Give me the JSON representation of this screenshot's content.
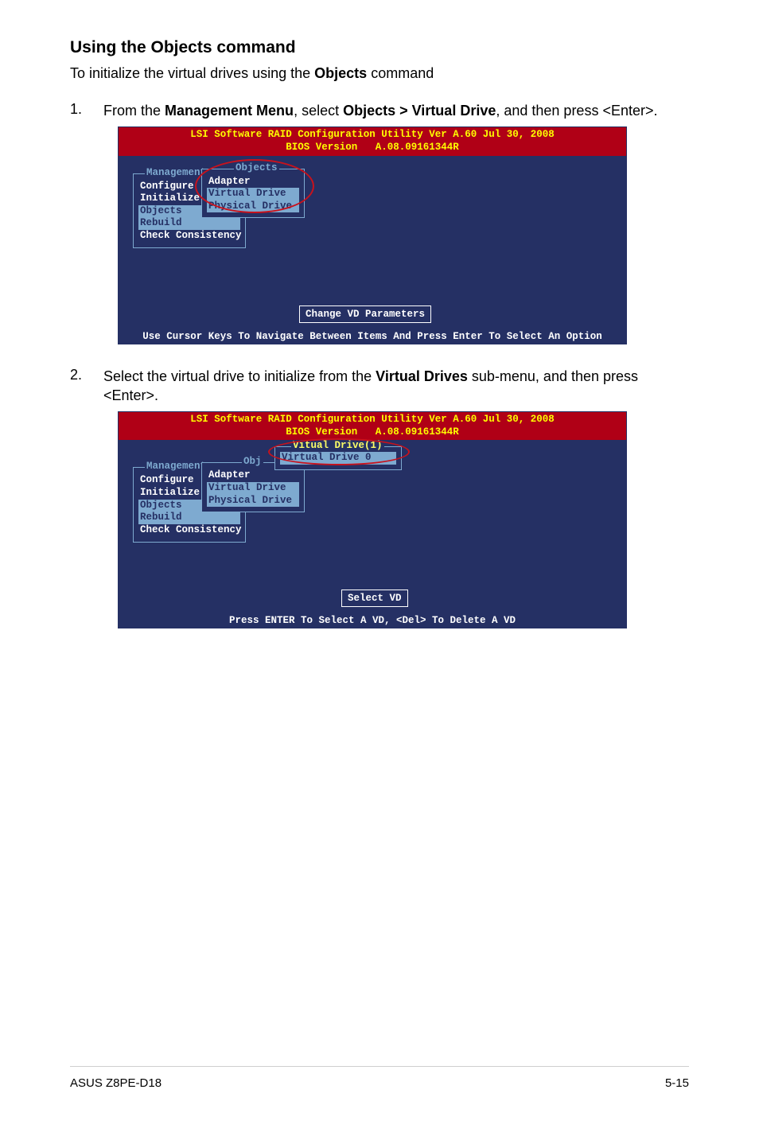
{
  "heading": "Using the Objects command",
  "intro": {
    "prefix": "To initialize the virtual drives using the ",
    "bold": "Objects",
    "suffix": " command"
  },
  "step1": {
    "number": "1.",
    "t1": "From the ",
    "b1": "Management Menu",
    "t2": ", select ",
    "b2": "Objects > Virtual Drive",
    "t3": ", and then press <Enter>."
  },
  "bios1": {
    "title_line1": "LSI Software RAID Configuration Utility Ver A.60 Jul 30, 2008",
    "title_line2": "BIOS Version   A.08.09161344R",
    "management_label": "Management",
    "management_items": [
      "Configure",
      "Initialize",
      "Objects",
      "Rebuild",
      "Check Consistency"
    ],
    "objects_label": "Objects",
    "objects_items": [
      "Adapter",
      "Virtual Drive",
      "Physical Drive"
    ],
    "status": "Change VD Parameters",
    "footer": "Use Cursor Keys To Navigate Between Items And Press Enter To Select An Option"
  },
  "step2": {
    "number": "2.",
    "t1": "Select the virtual drive to initialize from the ",
    "b1": "Virtual Drives",
    "t2": " sub-menu, and then press <Enter>."
  },
  "bios2": {
    "title_line1": "LSI Software RAID Configuration Utility Ver A.60 Jul 30, 2008",
    "title_line2": "BIOS Version   A.08.09161344R",
    "management_label": "Management",
    "management_items": [
      "Configure",
      "Initialize",
      "Objects",
      "Rebuild",
      "Check Consistency"
    ],
    "obj_label": "Obj",
    "obj_items": [
      "Adapter",
      "Virtual Drive",
      "Physical Drive"
    ],
    "vd_label": "Vitual Drive(1)",
    "vd_items": [
      "Virtual Drive 0"
    ],
    "status": "Select VD",
    "footer": "Press ENTER To Select A VD, <Del> To Delete A VD"
  },
  "page_footer": {
    "left": "ASUS Z8PE-D18",
    "right": "5-15"
  }
}
